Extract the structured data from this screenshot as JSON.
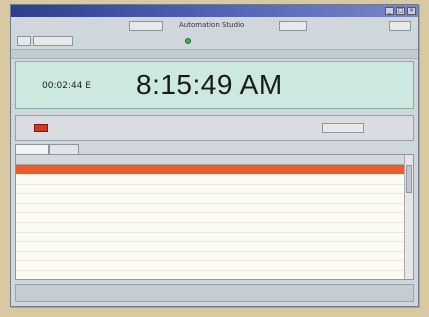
{
  "window": {
    "title": "",
    "controls": [
      "_",
      "□",
      "×"
    ]
  },
  "toolbar": {
    "left_text": "",
    "center_title": "Automation Studio",
    "right_text": "",
    "row2_items": [
      "",
      "",
      ""
    ],
    "row3_text": ""
  },
  "clock": {
    "counter": "00:02:44 E",
    "time": "8:15:49 AM"
  },
  "player": {
    "label": "",
    "center_text": "",
    "button": ""
  },
  "tabs": [
    "",
    ""
  ],
  "table": {
    "columns": [
      "",
      "",
      "",
      "",
      "",
      "",
      "",
      ""
    ],
    "rows": [
      [
        "",
        "",
        "",
        "",
        "",
        "",
        "",
        ""
      ],
      [
        "",
        "",
        "",
        "",
        "",
        "",
        "",
        ""
      ],
      [
        "",
        "",
        "",
        "",
        "",
        "",
        "",
        ""
      ],
      [
        "",
        "",
        "",
        "",
        "",
        "",
        "",
        ""
      ],
      [
        "",
        "",
        "",
        "",
        "",
        "",
        "",
        ""
      ],
      [
        "",
        "",
        "",
        "",
        "",
        "",
        "",
        ""
      ],
      [
        "",
        "",
        "",
        "",
        "",
        "",
        "",
        ""
      ],
      [
        "",
        "",
        "",
        "",
        "",
        "",
        "",
        ""
      ],
      [
        "",
        "",
        "",
        "",
        "",
        "",
        "",
        ""
      ],
      [
        "",
        "",
        "",
        "",
        "",
        "",
        "",
        ""
      ],
      [
        "",
        "",
        "",
        "",
        "",
        "",
        "",
        ""
      ],
      [
        "",
        "",
        "",
        "",
        "",
        "",
        "",
        ""
      ]
    ],
    "active_row": 0
  },
  "colors": {
    "clock_panel": "#cde9df",
    "active_row": "#ef5a2a",
    "title_bar": "#2c3f8c"
  }
}
